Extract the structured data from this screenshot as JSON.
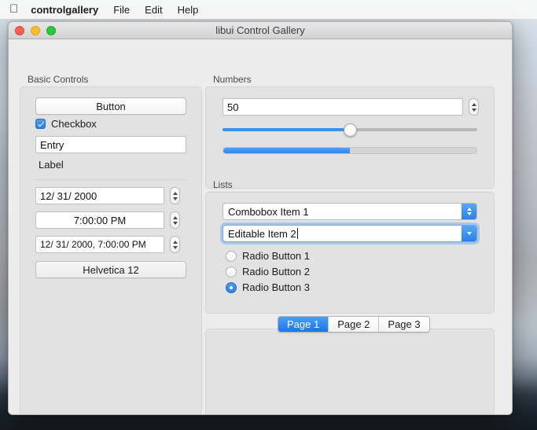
{
  "menubar": {
    "apple_icon": "apple-logo-icon",
    "app_name": "controlgallery",
    "items": [
      "File",
      "Edit",
      "Help"
    ]
  },
  "window": {
    "title": "libui Control Gallery",
    "traffic_lights": [
      "close",
      "minimize",
      "maximize"
    ]
  },
  "basic_controls": {
    "group_label": "Basic Controls",
    "button_label": "Button",
    "checkbox": {
      "label": "Checkbox",
      "checked": true
    },
    "entry_value": "Entry",
    "label_text": "Label",
    "date_value": "12/ 31/ 2000",
    "time_value": "7:00:00 PM",
    "datetime_value": "12/ 31/ 2000,  7:00:00 PM",
    "font_button_label": "Helvetica 12"
  },
  "numbers": {
    "group_label": "Numbers",
    "spinbox_value": "50",
    "slider_percent": 50,
    "progress_percent": 50
  },
  "lists": {
    "group_label": "Lists",
    "combobox_value": "Combobox Item 1",
    "editable_combobox_value": "Editable Item 2",
    "radio_buttons": [
      {
        "label": "Radio Button 1",
        "selected": false
      },
      {
        "label": "Radio Button 2",
        "selected": false
      },
      {
        "label": "Radio Button 3",
        "selected": true
      }
    ]
  },
  "tabs": {
    "items": [
      {
        "label": "Page 1",
        "selected": true
      },
      {
        "label": "Page 2",
        "selected": false
      },
      {
        "label": "Page 3",
        "selected": false
      }
    ]
  },
  "colors": {
    "accent_blue": "#2b80e8",
    "window_bg": "#ececec",
    "group_bg": "#e2e2e2"
  }
}
